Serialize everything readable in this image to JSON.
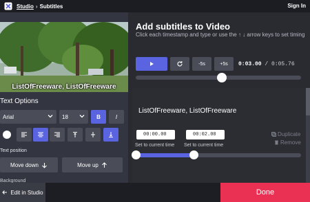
{
  "topbar": {
    "studio": "Studio",
    "separator": "›",
    "subtitles": "Subtitles",
    "sign_in": "Sign In"
  },
  "video": {
    "caption": "ListOfFreeware, ListOfFreeware"
  },
  "text_options": {
    "title": "Text Options",
    "font": "Arial",
    "size": "18",
    "bold": "B",
    "italic": "I",
    "text_position_label": "Text position",
    "move_down": "Move down",
    "move_up": "Move up",
    "background_label": "Background"
  },
  "main": {
    "title": "Add subtitles to Video",
    "subtitle": "Click each timestamp and type or use the ↑ ↓ arrow keys to set timing",
    "minus5": "-5s",
    "plus5": "+5s",
    "current_time": "0:03.00",
    "time_sep": " / ",
    "total_time": "0:05.76",
    "playhead": 0.52
  },
  "subtitle_card": {
    "text": "ListOfFreeware, ListOfFreeware",
    "start": "00:00.00",
    "end": "00:02.00",
    "set_current_start": "Set to current time",
    "set_current_end": "Set to current time",
    "duplicate": "Duplicate",
    "remove": "Remove",
    "range_start": 0.0,
    "range_end": 0.35
  },
  "footer": {
    "edit_in_studio": "Edit in Studio",
    "done": "Done"
  },
  "colors": {
    "accent": "#5a63e0",
    "done": "#ea3154",
    "panel": "#333540"
  }
}
